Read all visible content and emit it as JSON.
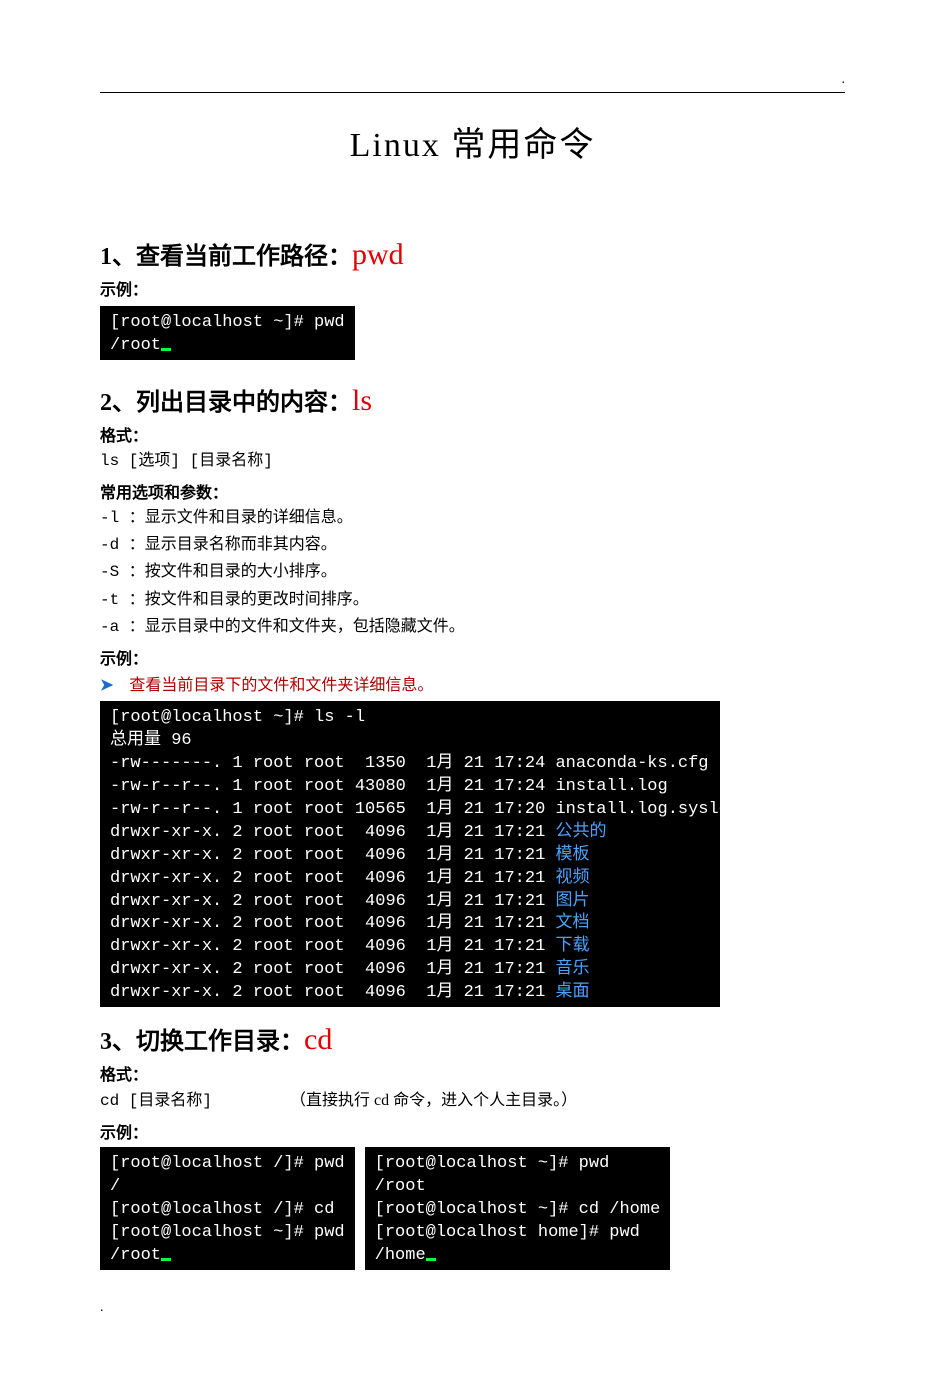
{
  "top_dot": ".",
  "title": "Linux 常用命令",
  "sec1": {
    "heading_pre": "1、查看当前工作路径：",
    "cmd": "pwd",
    "example_label": "示例：",
    "term": [
      "[root@localhost ~]# pwd",
      "/root"
    ]
  },
  "sec2": {
    "heading_pre": "2、列出目录中的内容：",
    "cmd": "ls",
    "format_label": "格式：",
    "format_text": "ls [选项] [目录名称]",
    "opts_label": "常用选项和参数：",
    "opts": [
      "-l  ：显示文件和目录的详细信息。",
      "-d  ：显示目录名称而非其内容。",
      "-S  ：按文件和目录的大小排序。",
      "-t  ：按文件和目录的更改时间排序。",
      "-a  ：显示目录中的文件和文件夹，包括隐藏文件。"
    ],
    "example_label": "示例：",
    "bullet": "查看当前目录下的文件和文件夹详细信息。",
    "term_cmd": "[root@localhost ~]# ls -l",
    "term_total": "总用量 96",
    "term_rows": [
      {
        "pre": "-rw-------. 1 root root  1350  1月 21 17:24 ",
        "name": "anaconda-ks.cfg",
        "blue": false
      },
      {
        "pre": "-rw-r--r--. 1 root root 43080  1月 21 17:24 ",
        "name": "install.log",
        "blue": false
      },
      {
        "pre": "-rw-r--r--. 1 root root 10565  1月 21 17:20 ",
        "name": "install.log.syslog",
        "blue": false
      },
      {
        "pre": "drwxr-xr-x. 2 root root  4096  1月 21 17:21 ",
        "name": "公共的",
        "blue": true
      },
      {
        "pre": "drwxr-xr-x. 2 root root  4096  1月 21 17:21 ",
        "name": "模板",
        "blue": true
      },
      {
        "pre": "drwxr-xr-x. 2 root root  4096  1月 21 17:21 ",
        "name": "视频",
        "blue": true
      },
      {
        "pre": "drwxr-xr-x. 2 root root  4096  1月 21 17:21 ",
        "name": "图片",
        "blue": true
      },
      {
        "pre": "drwxr-xr-x. 2 root root  4096  1月 21 17:21 ",
        "name": "文档",
        "blue": true
      },
      {
        "pre": "drwxr-xr-x. 2 root root  4096  1月 21 17:21 ",
        "name": "下载",
        "blue": true
      },
      {
        "pre": "drwxr-xr-x. 2 root root  4096  1月 21 17:21 ",
        "name": "音乐",
        "blue": true
      },
      {
        "pre": "drwxr-xr-x. 2 root root  4096  1月 21 17:21 ",
        "name": "桌面",
        "blue": true
      }
    ]
  },
  "sec3": {
    "heading_pre": "3、切换工作目录：",
    "cmd": "cd",
    "format_label": "格式：",
    "format_text": "cd [目录名称]",
    "format_note": "（直接执行 cd 命令，进入个人主目录。）",
    "example_label": "示例：",
    "left_term": [
      "[root@localhost /]# pwd",
      "/",
      "[root@localhost /]# cd",
      "[root@localhost ~]# pwd",
      "/root"
    ],
    "right_term": [
      "[root@localhost ~]# pwd",
      "/root",
      "[root@localhost ~]# cd /home",
      "[root@localhost home]# pwd",
      "/home"
    ]
  },
  "bottom_dot": "."
}
